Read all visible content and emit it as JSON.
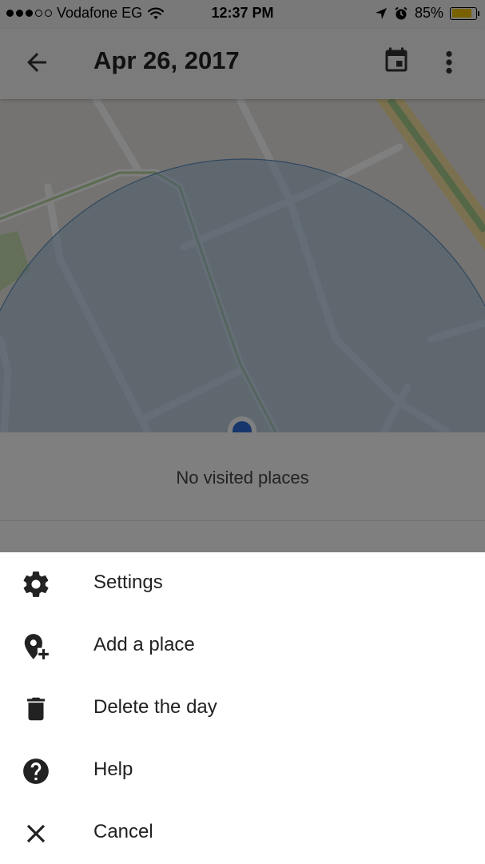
{
  "status_bar": {
    "carrier": "Vodafone EG",
    "signal_bars": 3,
    "time": "12:37 PM",
    "battery_percent": "85%",
    "battery_level": 0.85,
    "battery_color": "#f2c200"
  },
  "app_bar": {
    "title": "Apr 26, 2017",
    "back_icon": "arrow-back-icon",
    "calendar_icon": "calendar-icon",
    "more_icon": "more-vertical-icon"
  },
  "info_panel": {
    "message": "No visited places"
  },
  "menu": {
    "items": [
      {
        "label": "Settings",
        "icon": "gear-icon"
      },
      {
        "label": "Add a place",
        "icon": "add-location-icon"
      },
      {
        "label": "Delete the day",
        "icon": "trash-icon"
      },
      {
        "label": "Help",
        "icon": "help-icon"
      },
      {
        "label": "Cancel",
        "icon": "close-icon"
      }
    ]
  }
}
